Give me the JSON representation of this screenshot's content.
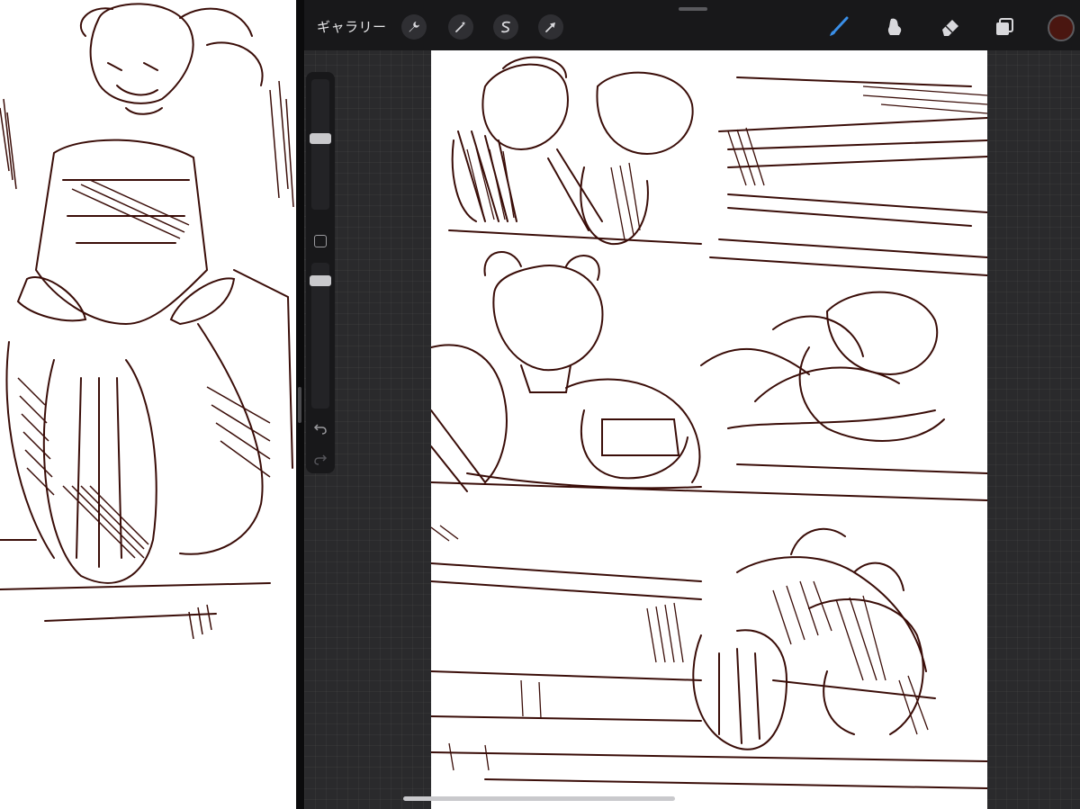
{
  "toolbar": {
    "gallery_label": "ギャラリー",
    "left_tools": [
      {
        "icon": "wrench-icon",
        "name": "actions"
      },
      {
        "icon": "magic-wand-icon",
        "name": "adjustments"
      },
      {
        "icon": "selection-s-icon",
        "name": "selection"
      },
      {
        "icon": "arrow-cursor-icon",
        "name": "transform"
      }
    ],
    "right_tools": [
      {
        "icon": "brush-icon",
        "name": "paint",
        "active": true,
        "color": "#3a8fe8"
      },
      {
        "icon": "smudge-icon",
        "name": "smudge",
        "active": false
      },
      {
        "icon": "eraser-icon",
        "name": "erase",
        "active": false
      },
      {
        "icon": "layers-icon",
        "name": "layers",
        "active": false
      }
    ],
    "current_color": "#4a1610"
  },
  "sidebar": {
    "brush_size_level": 0.5,
    "opacity_level": 0.9,
    "undo_icon": "undo-icon",
    "redo_icon": "redo-icon",
    "modify_icon": "modify-square-icon"
  },
  "ink_color": "#3a0d08"
}
